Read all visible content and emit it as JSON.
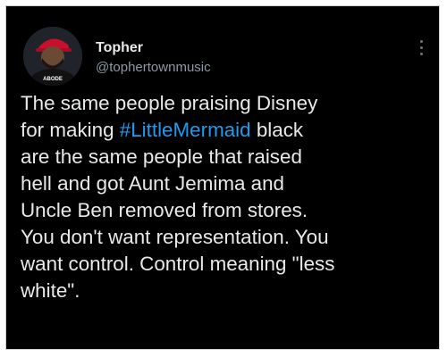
{
  "user": {
    "name": "Topher",
    "handle": "@tophertownmusic",
    "avatar_shirt_text": "ABODE"
  },
  "tweet": {
    "line1": "The same people praising Disney",
    "line2_pre": "for making ",
    "hashtag": "#LittleMermaid",
    "line2_post": " black",
    "line3": "are the same people that raised",
    "line4": "hell and got Aunt Jemima and",
    "line5": "Uncle Ben removed from stores.",
    "line6": "You don't want representation. You",
    "line7": "want control. Control meaning \"less",
    "line8": "white\"."
  },
  "colors": {
    "background": "#000000",
    "text": "#e7e9ea",
    "secondary": "#8b98a5",
    "link": "#1d9bf0"
  },
  "icons": {
    "menu": "more-vertical-icon"
  }
}
